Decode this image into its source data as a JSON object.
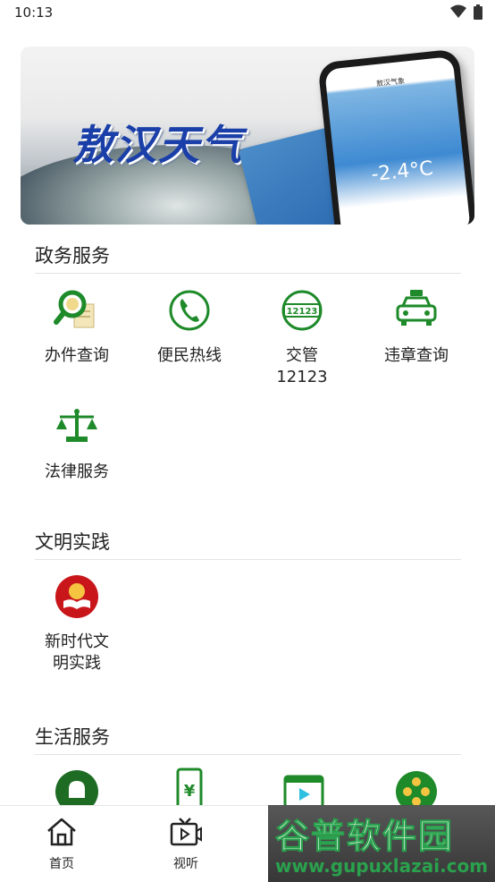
{
  "status_bar": {
    "time": "10:13"
  },
  "banner": {
    "title": "敖汉天气",
    "phone_title": "敖汉气象",
    "temperature": "-2.4°C"
  },
  "sections": [
    {
      "title": "政务服务",
      "items": [
        {
          "label": "办件查询",
          "icon": "document-search-icon"
        },
        {
          "label": "便民热线",
          "icon": "phone-icon"
        },
        {
          "label": "交管\n12123",
          "icon": "traffic-12123-icon"
        },
        {
          "label": "违章查询",
          "icon": "taxi-icon"
        },
        {
          "label": "法律服务",
          "icon": "scales-icon"
        }
      ]
    },
    {
      "title": "文明实践",
      "items": [
        {
          "label": "新时代文\n明实践",
          "icon": "party-book-icon"
        }
      ]
    },
    {
      "title": "生活服务",
      "items": [
        {
          "label": "",
          "icon": "bell-icon"
        },
        {
          "label": "",
          "icon": "mobile-payment-icon"
        },
        {
          "label": "",
          "icon": "video-clapper-icon"
        },
        {
          "label": "",
          "icon": "film-reel-icon"
        }
      ]
    }
  ],
  "tabbar": {
    "items": [
      {
        "label": "首页",
        "icon": "home-icon"
      },
      {
        "label": "视听",
        "icon": "tv-icon"
      }
    ]
  },
  "watermark": {
    "brand": "谷普软件园",
    "url": "www.gupuxlazai.com"
  },
  "colors": {
    "icon_green": "#1e8a2a",
    "party_red": "#c9161b"
  }
}
